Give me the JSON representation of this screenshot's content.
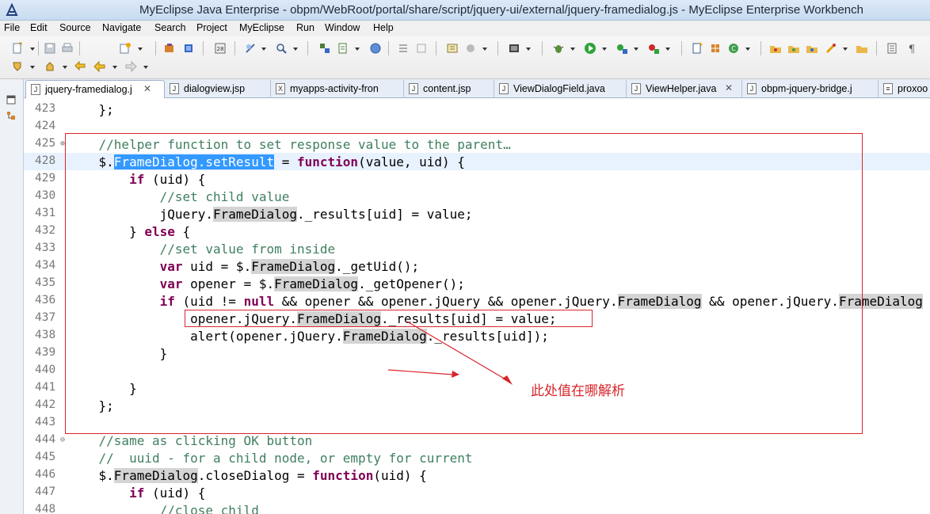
{
  "window": {
    "title": "MyEclipse Java Enterprise - obpm/WebRoot/portal/share/script/jquery-ui/external/jquery-framedialog.js - MyEclipse Enterprise Workbench"
  },
  "menu": [
    "File",
    "Edit",
    "Source",
    "Navigate",
    "Search",
    "Project",
    "MyEclipse",
    "Run",
    "Window",
    "Help"
  ],
  "tabs": [
    {
      "label": "jquery-framedialog.j",
      "icon": "js-file-icon",
      "active": true,
      "closable": true
    },
    {
      "label": "dialogview.jsp",
      "icon": "jsp-file-icon"
    },
    {
      "label": "myapps-activity-fron",
      "icon": "js-file-icon"
    },
    {
      "label": "content.jsp",
      "icon": "jsp-file-icon"
    },
    {
      "label": "ViewDialogField.java",
      "icon": "java-file-icon"
    },
    {
      "label": "ViewHelper.java",
      "icon": "java-file-icon",
      "closable": true
    },
    {
      "label": "obpm-jquery-bridge.j",
      "icon": "js-file-icon"
    },
    {
      "label": "proxoo",
      "icon": "file-icon"
    }
  ],
  "code_lines": [
    {
      "n": "423",
      "text": "    };"
    },
    {
      "n": "424",
      "text": ""
    },
    {
      "n": "425",
      "fold": "⊕",
      "text": "    //helper function to set response value to the parent…"
    },
    {
      "n": "428",
      "text": "    $.FrameDialog.setResult = function(value, uid) {",
      "current": true
    },
    {
      "n": "429",
      "text": "        if (uid) {"
    },
    {
      "n": "430",
      "text": "            //set child value"
    },
    {
      "n": "431",
      "text": "            jQuery.FrameDialog._results[uid] = value;"
    },
    {
      "n": "432",
      "text": "        } else {"
    },
    {
      "n": "433",
      "text": "            //set value from inside"
    },
    {
      "n": "434",
      "text": "            var uid = $.FrameDialog._getUid();"
    },
    {
      "n": "435",
      "text": "            var opener = $.FrameDialog._getOpener();"
    },
    {
      "n": "436",
      "text": "            if (uid != null && opener && opener.jQuery && opener.jQuery.FrameDialog && opener.jQuery.FrameDialog"
    },
    {
      "n": "437",
      "text": "                opener.jQuery.FrameDialog._results[uid] = value;"
    },
    {
      "n": "438",
      "text": "                alert(opener.jQuery.FrameDialog._results[uid]);"
    },
    {
      "n": "439",
      "text": "            }"
    },
    {
      "n": "440",
      "text": ""
    },
    {
      "n": "441",
      "text": "        }"
    },
    {
      "n": "442",
      "text": "    };"
    },
    {
      "n": "443",
      "text": ""
    },
    {
      "n": "444",
      "fold": "⊖",
      "text": "    //same as clicking OK button"
    },
    {
      "n": "445",
      "text": "    //  uuid - for a child node, or empty for current"
    },
    {
      "n": "446",
      "text": "    $.FrameDialog.closeDialog = function(uid) {"
    },
    {
      "n": "447",
      "text": "        if (uid) {"
    },
    {
      "n": "448",
      "text": "            //close child"
    }
  ],
  "annotation": {
    "text": "此处值在哪解析",
    "color": "#d9252a"
  },
  "colors": {
    "keyword": "#7f0055",
    "comment": "#3f7f5f",
    "selection": "#3399ff",
    "current_line": "#e8f2fe"
  }
}
